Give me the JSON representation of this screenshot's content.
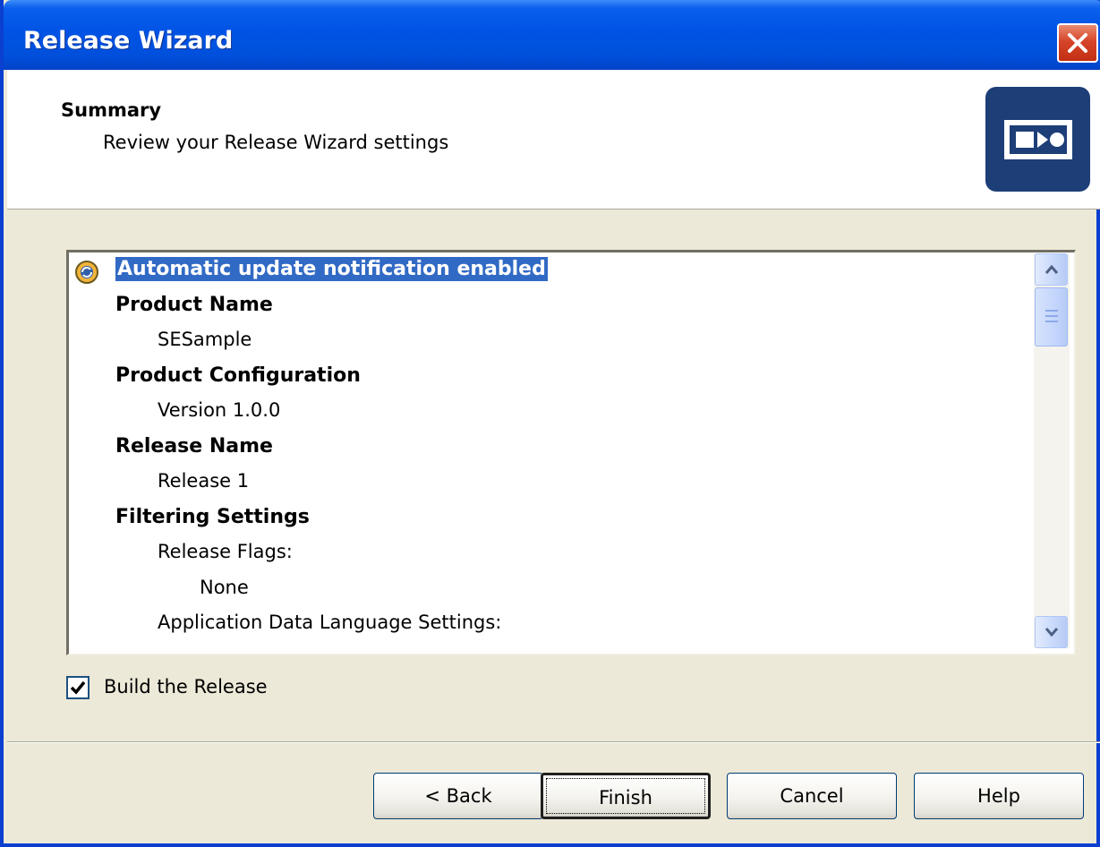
{
  "window": {
    "title": "Release Wizard"
  },
  "header": {
    "title": "Summary",
    "subtitle": "Review your Release Wizard settings"
  },
  "summary_list": {
    "items": [
      {
        "text": "Automatic update notification enabled",
        "level": 1,
        "bold": true,
        "selected": true,
        "icon": "update-notification-icon"
      },
      {
        "text": "Product Name",
        "level": 1,
        "bold": true
      },
      {
        "text": "SESample",
        "level": 2,
        "bold": false
      },
      {
        "text": "Product Configuration",
        "level": 1,
        "bold": true
      },
      {
        "text": "Version 1.0.0",
        "level": 2,
        "bold": false
      },
      {
        "text": "Release Name",
        "level": 1,
        "bold": true
      },
      {
        "text": "Release 1",
        "level": 2,
        "bold": false
      },
      {
        "text": "Filtering Settings",
        "level": 1,
        "bold": true
      },
      {
        "text": "Release Flags:",
        "level": 2,
        "bold": false
      },
      {
        "text": "None",
        "level": 3,
        "bold": false
      },
      {
        "text": "Application Data Language Settings:",
        "level": 2,
        "bold": false
      }
    ]
  },
  "build_checkbox": {
    "label": "Build the Release",
    "checked": true
  },
  "buttons": {
    "back": "< Back",
    "finish": "Finish",
    "cancel": "Cancel",
    "help": "Help"
  },
  "colors": {
    "titlebar": "#0054E3",
    "selection": "#316AC5",
    "dialog_bg": "#ECE9D8",
    "logo_bg": "#1D3E77"
  }
}
